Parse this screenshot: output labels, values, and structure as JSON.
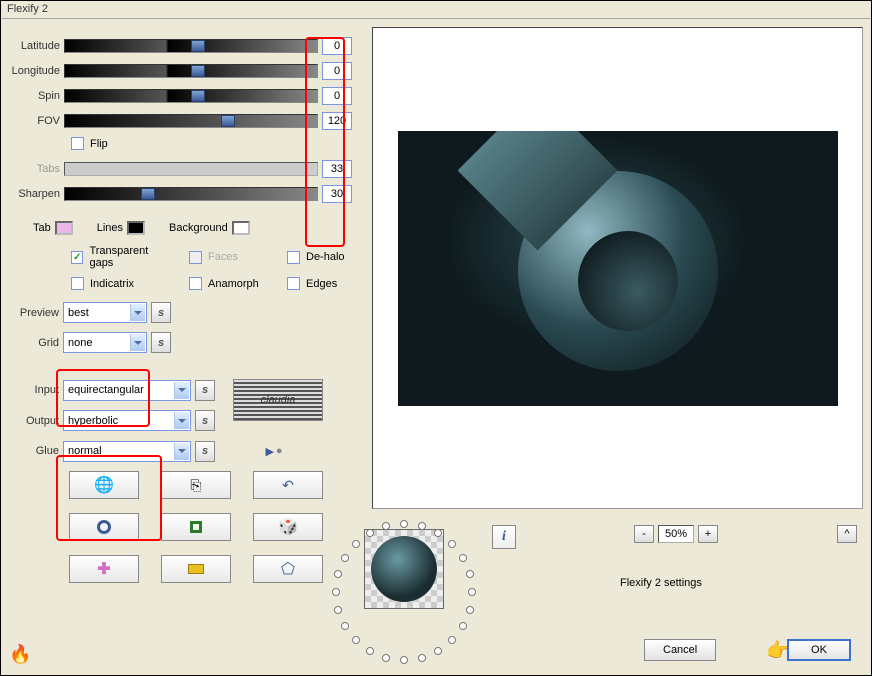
{
  "window": {
    "title": "Flexify 2"
  },
  "sliders": {
    "latitude": {
      "label": "Latitude",
      "value": "0",
      "thumb_pct": 50
    },
    "longitude": {
      "label": "Longitude",
      "value": "0",
      "thumb_pct": 50
    },
    "spin": {
      "label": "Spin",
      "value": "0",
      "thumb_pct": 50
    },
    "fov": {
      "label": "FOV",
      "value": "120",
      "thumb_pct": 62
    },
    "tabs": {
      "label": "Tabs",
      "value": "33",
      "thumb_pct": 0,
      "disabled": true
    },
    "sharpen": {
      "label": "Sharpen",
      "value": "30",
      "thumb_pct": 30
    }
  },
  "flip": {
    "label": "Flip",
    "checked": false
  },
  "colors": {
    "tab": {
      "label": "Tab",
      "hex": "#e9b8e6"
    },
    "lines": {
      "label": "Lines",
      "hex": "#000000"
    },
    "background": {
      "label": "Background",
      "hex": "#ffffff"
    }
  },
  "checks": {
    "transparent_gaps": {
      "label": "Transparent gaps",
      "checked": true
    },
    "faces": {
      "label": "Faces",
      "checked": false,
      "disabled": true
    },
    "dehalo": {
      "label": "De-halo",
      "checked": false
    },
    "indicatrix": {
      "label": "Indicatrix",
      "checked": false
    },
    "anamorph": {
      "label": "Anamorph",
      "checked": false
    },
    "edges": {
      "label": "Edges",
      "checked": false
    }
  },
  "dropdowns": {
    "preview": {
      "label": "Preview",
      "value": "best"
    },
    "grid": {
      "label": "Grid",
      "value": "none"
    },
    "input": {
      "label": "Input",
      "value": "equirectangular"
    },
    "output": {
      "label": "Output",
      "value": "hyperbolic"
    },
    "glue": {
      "label": "Glue",
      "value": "normal"
    }
  },
  "logo_text": "claudia",
  "zoom": {
    "dec": "-",
    "value": "50%",
    "inc": "+"
  },
  "settings_label": "Flexify 2 settings",
  "buttons": {
    "cancel": "Cancel",
    "ok": "OK",
    "expand": "^",
    "info": "i",
    "s": "s"
  }
}
